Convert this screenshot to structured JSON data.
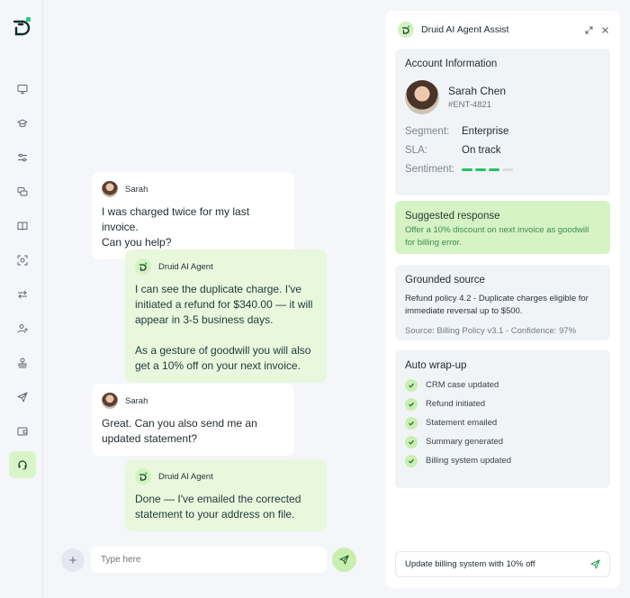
{
  "sidebar": {
    "logo_icon": "druid-logo-icon",
    "items": [
      {
        "icon": "monitor-icon"
      },
      {
        "icon": "graduation-icon"
      },
      {
        "icon": "toggles-icon"
      },
      {
        "icon": "chat-bubbles-icon"
      },
      {
        "icon": "book-icon"
      },
      {
        "icon": "scan-icon"
      },
      {
        "icon": "transfer-icon"
      },
      {
        "icon": "user-settings-icon"
      },
      {
        "icon": "stamp-icon"
      },
      {
        "icon": "send-icon"
      },
      {
        "icon": "wallet-icon"
      },
      {
        "icon": "headset-icon",
        "active": true
      }
    ]
  },
  "chat": {
    "messages": [
      {
        "sender": "Sarah",
        "role": "user",
        "text": "I was charged twice for my last invoice.\nCan you help?"
      },
      {
        "sender": "Druid AI Agent",
        "role": "agent",
        "text": "I can see the duplicate charge. I've initiated a refund for $340.00 — it will appear in 3-5 business days.\n\nAs a gesture of goodwill you will also get a 10% off on your next invoice."
      },
      {
        "sender": "Sarah",
        "role": "user",
        "text": "Great. Can you also send me an updated statement?"
      },
      {
        "sender": "Druid AI Agent",
        "role": "agent",
        "text": "Done — I've emailed the corrected statement to your address on file."
      }
    ],
    "composer": {
      "placeholder": "Type here",
      "plus_label": "+"
    }
  },
  "panel": {
    "title": "Druid AI Agent Assist",
    "account": {
      "title": "Account Information",
      "name": "Sarah Chen",
      "id": "#ENT-4821",
      "segment_label": "Segment:",
      "segment_value": "Enterprise",
      "sla_label": "SLA:",
      "sla_value": "On track",
      "sentiment_label": "Sentiment:",
      "sentiment_level": 3,
      "sentiment_max": 4
    },
    "suggested": {
      "title": "Suggested response",
      "text": "Offer a 10% discount on next invoice as goodwill for billing error."
    },
    "grounded": {
      "title": "Grounded source",
      "text": "Refund policy 4.2 - Duplicate charges eligible for immediate reversal up to $500.",
      "meta": "Source: Billing Policy v3.1 - Confidence: 97%"
    },
    "wrapup": {
      "title": "Auto wrap-up",
      "items": [
        "CRM case updated",
        "Refund initiated",
        "Statement emailed",
        "Summary generated",
        "Billing system updated"
      ]
    },
    "input_value": "Update billing system with 10% off"
  },
  "colors": {
    "accent": "#22c55e",
    "agent_bubble": "#e9f7dd",
    "suggest_bg": "#d6f3c4"
  }
}
